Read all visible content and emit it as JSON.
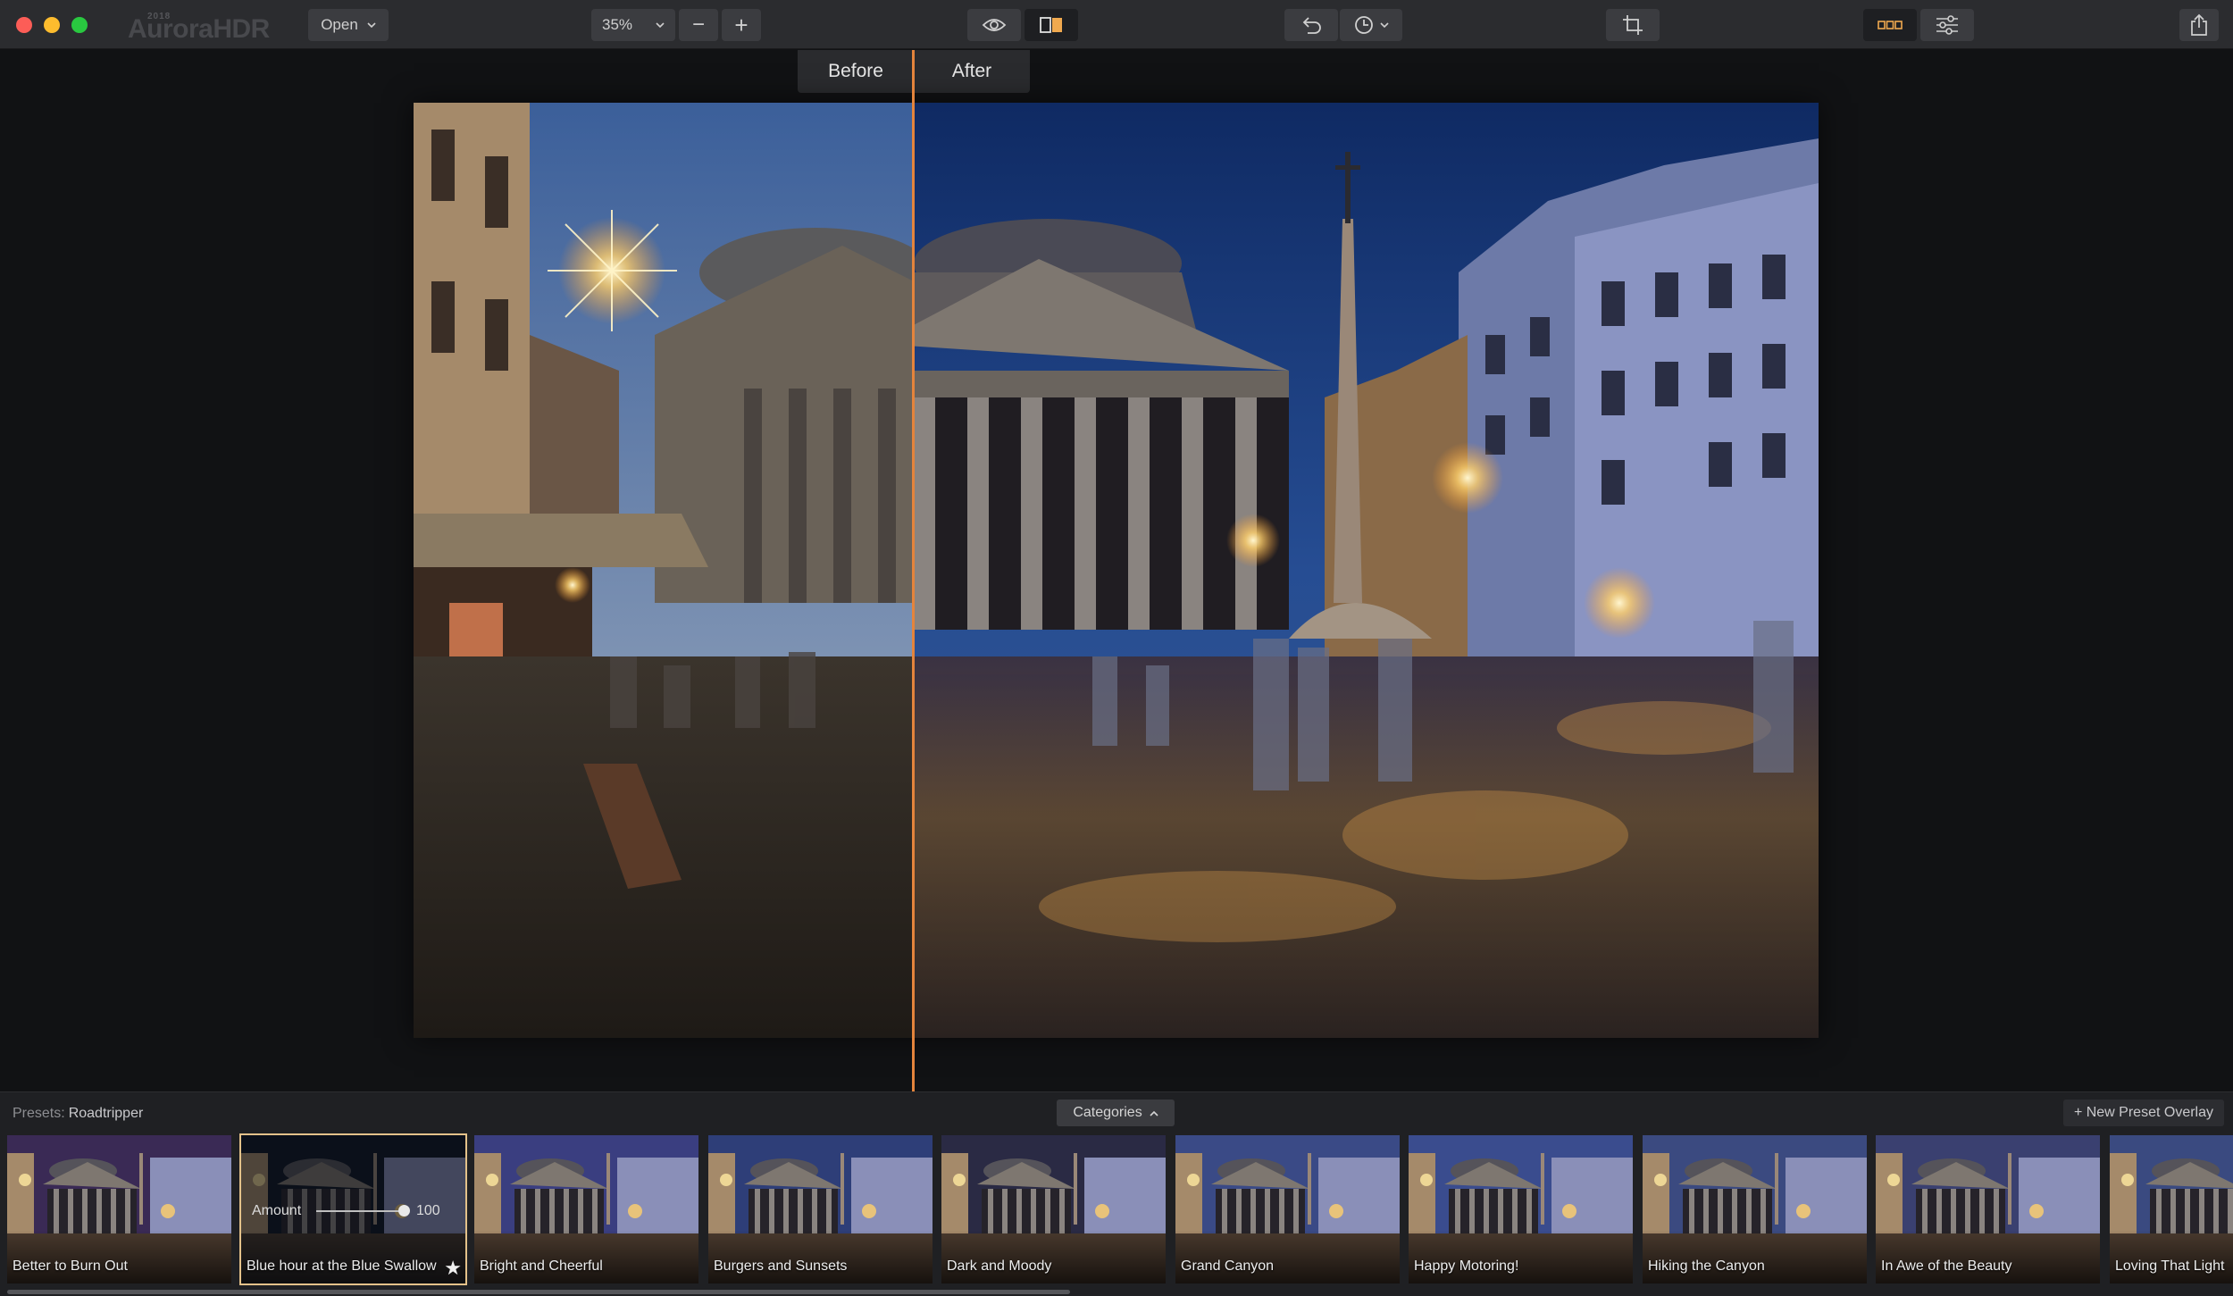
{
  "app": {
    "logo_year": "2018",
    "logo_name": "AuroraHDR"
  },
  "toolbar": {
    "open_label": "Open",
    "zoom_value": "35%",
    "zoom_out_symbol": "−",
    "zoom_in_symbol": "+",
    "icons": [
      "eye-icon",
      "compare-icon",
      "undo-icon",
      "history-icon",
      "crop-icon",
      "presets-view-icon",
      "adjustments-icon",
      "share-icon"
    ]
  },
  "compare": {
    "before_label": "Before",
    "after_label": "After",
    "split_color": "#e4843c"
  },
  "presets": {
    "title_prefix": "Presets:",
    "title_value": "Roadtripper",
    "categories_label": "Categories",
    "new_overlay_label": "+ New Preset Overlay",
    "selected_index": 1,
    "amount_label": "Amount",
    "amount_value": "100",
    "amount_fraction": 1.0,
    "items": [
      {
        "label": "Better to Burn Out"
      },
      {
        "label": "Blue hour at the Blue Swallow"
      },
      {
        "label": "Bright and Cheerful"
      },
      {
        "label": "Burgers and Sunsets"
      },
      {
        "label": "Dark and Moody"
      },
      {
        "label": "Grand Canyon"
      },
      {
        "label": "Happy Motoring!"
      },
      {
        "label": "Hiking the Canyon"
      },
      {
        "label": "In Awe of the Beauty"
      },
      {
        "label": "Loving That Light"
      }
    ]
  },
  "colors": {
    "accent": "#e4843c",
    "selection": "#e4c28a",
    "toolbar_bg": "#2b2c2f",
    "panel_bg": "#1f2023"
  }
}
